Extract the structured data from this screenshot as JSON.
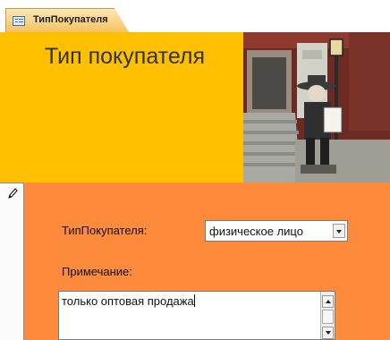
{
  "tab": {
    "label": "ТипПокупателя",
    "icon": "form-icon"
  },
  "header": {
    "title": "Тип покупателя",
    "background": "#ffc000",
    "image": "street-statue-photo"
  },
  "record_selector": {
    "icon": "pencil-icon"
  },
  "form": {
    "background": "#fd8b3b",
    "type_field": {
      "label": "ТипПокупателя:",
      "value": "физическое лицо",
      "button_icon": "dropdown-arrow-icon"
    },
    "note_field": {
      "label": "Примечание:",
      "value": "только оптовая продажа"
    }
  }
}
